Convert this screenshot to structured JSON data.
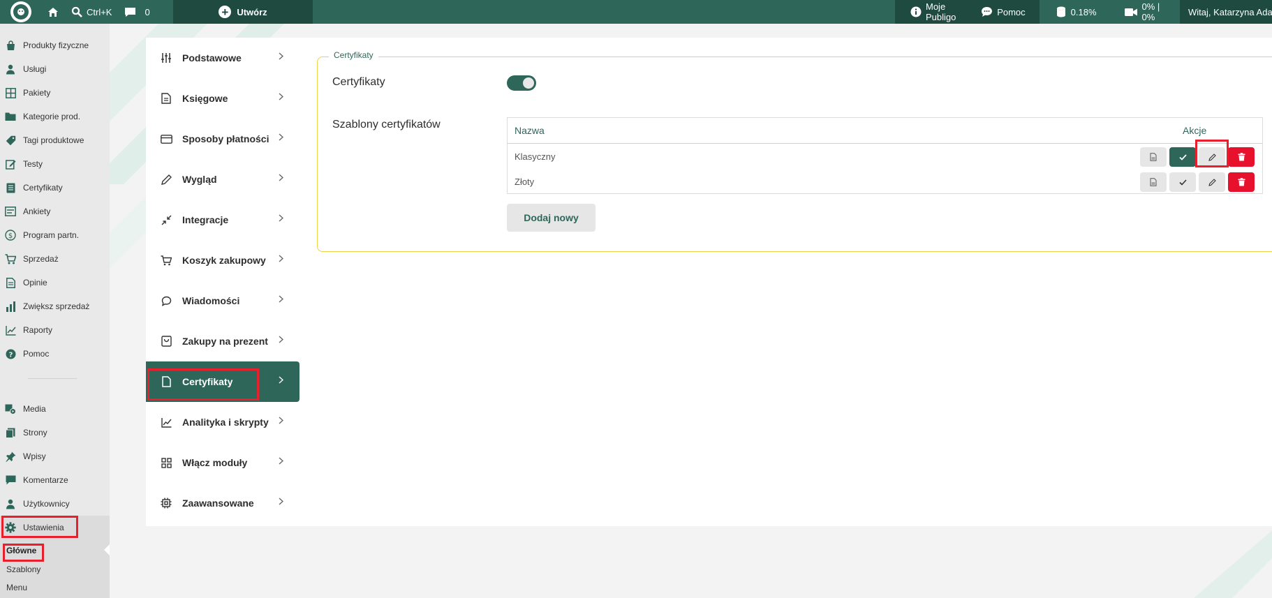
{
  "topbar": {
    "search_shortcut": "Ctrl+K",
    "comments_count": "0",
    "create_label": "Utwórz",
    "my_publigo": "Moje Publigo",
    "help": "Pomoc",
    "storage": "0.18%",
    "video": "0% | 0%",
    "greeting": "Witaj, Katarzyna Ada"
  },
  "sidebar": {
    "items": [
      {
        "label": "Produkty fizyczne",
        "icon": "bag-icon"
      },
      {
        "label": "Usługi",
        "icon": "user-icon"
      },
      {
        "label": "Pakiety",
        "icon": "grid-icon"
      },
      {
        "label": "Kategorie prod.",
        "icon": "folder-icon"
      },
      {
        "label": "Tagi produktowe",
        "icon": "tag-icon"
      },
      {
        "label": "Testy",
        "icon": "pencil-square-icon"
      },
      {
        "label": "Certyfikaty",
        "icon": "document-icon"
      },
      {
        "label": "Ankiety",
        "icon": "form-icon"
      },
      {
        "label": "Program partn.",
        "icon": "dollar-icon"
      },
      {
        "label": "Sprzedaż",
        "icon": "cart-icon"
      },
      {
        "label": "Opinie",
        "icon": "page-icon"
      },
      {
        "label": "Zwiększ sprzedaż",
        "icon": "bar-chart-icon"
      },
      {
        "label": "Raporty",
        "icon": "line-chart-icon"
      },
      {
        "label": "Pomoc",
        "icon": "question-icon"
      },
      {
        "label": "Media",
        "icon": "media-icon"
      },
      {
        "label": "Strony",
        "icon": "pages-icon"
      },
      {
        "label": "Wpisy",
        "icon": "pin-icon"
      },
      {
        "label": "Komentarze",
        "icon": "comment-icon"
      },
      {
        "label": "Użytkownicy",
        "icon": "user-icon"
      },
      {
        "label": "Ustawienia",
        "icon": "gear-icon"
      }
    ],
    "submenu": [
      "Główne",
      "Szablony",
      "Menu"
    ]
  },
  "settings_nav": [
    {
      "label": "Podstawowe",
      "icon": "sliders-icon"
    },
    {
      "label": "Księgowe",
      "icon": "document-icon"
    },
    {
      "label": "Sposoby płatności",
      "icon": "card-icon"
    },
    {
      "label": "Wygląd",
      "icon": "pencil-icon"
    },
    {
      "label": "Integracje",
      "icon": "compress-icon"
    },
    {
      "label": "Koszyk zakupowy",
      "icon": "cart-icon"
    },
    {
      "label": "Wiadomości",
      "icon": "chat-icon"
    },
    {
      "label": "Zakupy na prezent",
      "icon": "gift-bag-icon"
    },
    {
      "label": "Certyfikaty",
      "icon": "file-icon"
    },
    {
      "label": "Analityka i skrypty",
      "icon": "chart-icon"
    },
    {
      "label": "Włącz moduły",
      "icon": "modules-icon"
    },
    {
      "label": "Zaawansowane",
      "icon": "chip-icon"
    }
  ],
  "certificates": {
    "legend": "Certyfikaty",
    "toggle_label": "Certyfikaty",
    "toggle_on": true,
    "templates_label": "Szablony certyfikatów",
    "table": {
      "headers": [
        "Nazwa",
        "Akcje"
      ],
      "rows": [
        {
          "name": "Klasyczny",
          "active": true
        },
        {
          "name": "Złoty",
          "active": false
        }
      ]
    },
    "add_button": "Dodaj nowy"
  },
  "colors": {
    "primary": "#2f665a",
    "primary_dark": "#1e4a40",
    "danger": "#e8112d",
    "highlight": "#e8202e",
    "fieldset_border": "#f0d24a"
  }
}
